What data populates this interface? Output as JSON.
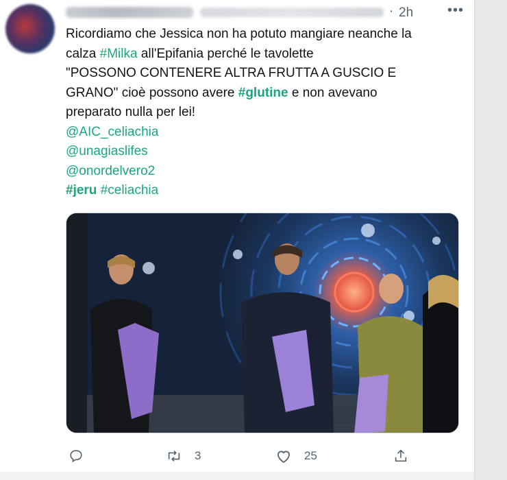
{
  "tweet": {
    "time": "2h",
    "more_label": "•••",
    "text_lines": [
      [
        {
          "t": "Ricordiamo che Jessica non ha potuto mangiare neanche la",
          "s": "n"
        }
      ],
      [
        {
          "t": "calza ",
          "s": "n"
        },
        {
          "t": "#Milka",
          "s": "h"
        },
        {
          "t": " all'Epifania perché le tavolette",
          "s": "n"
        }
      ],
      [
        {
          "t": "\"POSSONO CONTENERE ALTRA FRUTTA A GUSCIO E",
          "s": "n"
        }
      ],
      [
        {
          "t": "GRANO\" cioè possono avere ",
          "s": "n"
        },
        {
          "t": "#glutine",
          "s": "b"
        },
        {
          "t": " e non avevano",
          "s": "n"
        }
      ],
      [
        {
          "t": "preparato nulla per lei!",
          "s": "n"
        }
      ],
      [
        {
          "t": "@AIC_celiachia",
          "s": "h"
        }
      ],
      [
        {
          "t": "@unagiaslifes",
          "s": "h"
        }
      ],
      [
        {
          "t": "@onordelvero2",
          "s": "h"
        }
      ],
      [
        {
          "t": "#jeru",
          "s": "b"
        },
        {
          "t": " ",
          "s": "n"
        },
        {
          "t": "#celiachia",
          "s": "h"
        }
      ]
    ],
    "actions": {
      "reply_count": "",
      "retweet_count": "3",
      "like_count": "25"
    }
  },
  "colors": {
    "link": "#1da57c",
    "text": "#0f1419",
    "secondary": "#536471"
  }
}
